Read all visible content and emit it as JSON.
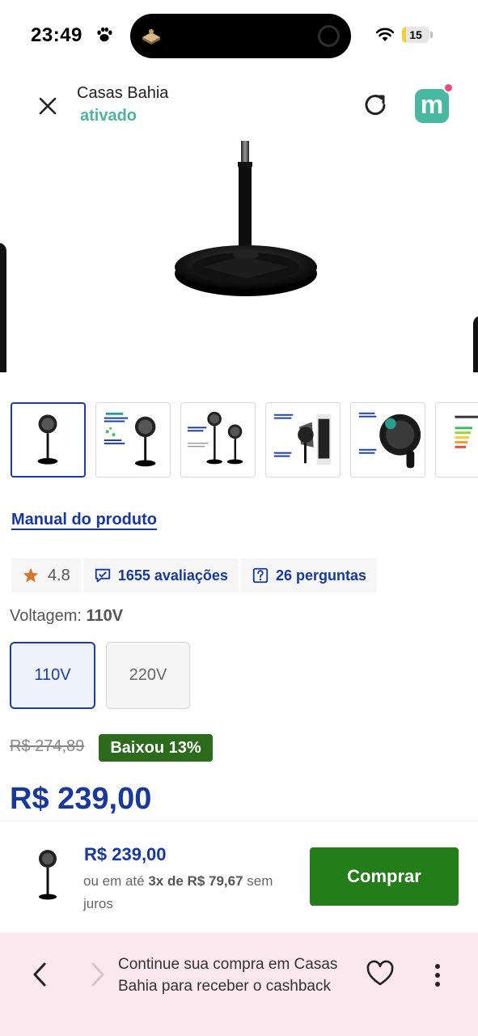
{
  "status_bar": {
    "time": "23:49",
    "battery_level": "15",
    "battery_fraction": 0.15
  },
  "nav": {
    "title": "Casas Bahia",
    "subtitle": "ativado",
    "logo_letter": "m"
  },
  "product": {
    "manual_link": "Manual do produto",
    "rating": "4.8",
    "reviews": "1655 avaliações",
    "questions": "26 perguntas",
    "voltage_label": "Voltagem:",
    "voltage_selected": "110V",
    "voltage_options": [
      "110V",
      "220V"
    ],
    "old_price": "R$ 274,89",
    "discount": "Baixou 13%",
    "price": "R$ 239,00"
  },
  "buy_bar": {
    "price": "R$ 239,00",
    "install_prefix": "ou em até",
    "install_value": "3x de R$ 79,67",
    "install_suffix": "sem juros",
    "button": "Comprar"
  },
  "bottom_bar": {
    "cashback_message": "Continue sua compra em Casas Bahia para receber o cashback"
  },
  "colors": {
    "primary_blue": "#17389c",
    "buy_green": "#237d18",
    "badge_green": "#2b6b1b",
    "brand_teal": "#49b8a1",
    "bottom_bar_bg": "#fbe8ee"
  },
  "icons": [
    "paw-icon",
    "wifi-icon",
    "close-icon",
    "reload-icon",
    "star-icon",
    "chat-icon",
    "question-icon",
    "chevron-left-icon",
    "chevron-right-icon",
    "heart-icon",
    "more-vertical-icon"
  ]
}
